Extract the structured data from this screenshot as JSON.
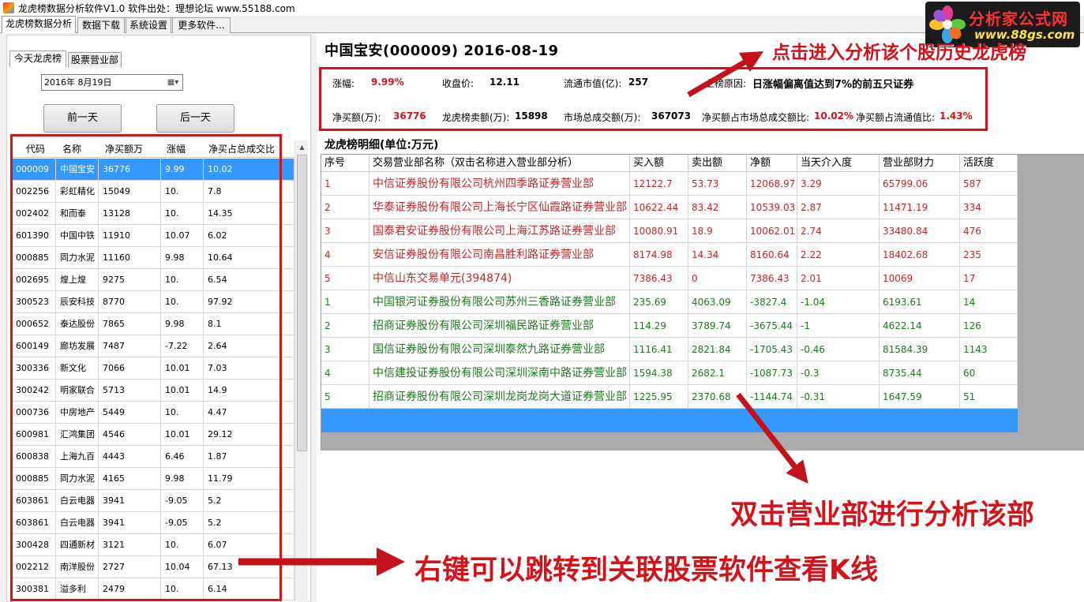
{
  "window": {
    "title": "龙虎榜数据分析软件V1.0 软件出处：理想论坛 www.55188.com"
  },
  "main_tabs": [
    {
      "label": "龙虎榜数据分析"
    },
    {
      "label": "数据下载"
    },
    {
      "label": "系统设置"
    },
    {
      "label": "更多软件..."
    }
  ],
  "left": {
    "tabs": [
      {
        "label": "今天龙虎榜"
      },
      {
        "label": "股票营业部"
      }
    ],
    "date_value": "2016年  8月19日",
    "calendar_icon": "calendar-dropdown-icon",
    "prev_label": "前一天",
    "next_label": "后一天",
    "columns": [
      "代码",
      "名称",
      "净买额万",
      "涨幅",
      "净买占总成交比"
    ],
    "rows": [
      [
        "000009",
        "中国宝安",
        "36776",
        "9.99",
        "10.02"
      ],
      [
        "002256",
        "彩虹精化",
        "15049",
        "10.",
        "7.8"
      ],
      [
        "002402",
        "和而泰",
        "13128",
        "10.",
        "14.35"
      ],
      [
        "601390",
        "中国中铁",
        "11910",
        "10.07",
        "6.02"
      ],
      [
        "000885",
        "同力水泥",
        "11160",
        "9.98",
        "10.64"
      ],
      [
        "002695",
        "煌上煌",
        "9275",
        "10.",
        "6.54"
      ],
      [
        "300523",
        "辰安科技",
        "8770",
        "10.",
        "97.92"
      ],
      [
        "000652",
        "泰达股份",
        "7865",
        "9.98",
        "8.1"
      ],
      [
        "600149",
        "廊坊发展",
        "7487",
        "-7.22",
        "2.64"
      ],
      [
        "300336",
        "新文化",
        "7066",
        "10.01",
        "7.03"
      ],
      [
        "300242",
        "明家联合",
        "5713",
        "10.01",
        "14.9"
      ],
      [
        "000736",
        "中房地产",
        "5449",
        "10.",
        "4.47"
      ],
      [
        "600981",
        "汇鸿集团",
        "4546",
        "10.01",
        "29.12"
      ],
      [
        "600838",
        "上海九百",
        "4443",
        "6.46",
        "1.87"
      ],
      [
        "000885",
        "同力水泥",
        "4165",
        "9.98",
        "11.79"
      ],
      [
        "603861",
        "白云电器",
        "3941",
        "-9.05",
        "5.2"
      ],
      [
        "603861",
        "白云电器",
        "3941",
        "-9.05",
        "5.2"
      ],
      [
        "300428",
        "四通新材",
        "3121",
        "10.",
        "6.07"
      ],
      [
        "002212",
        "南洋股份",
        "2727",
        "10.04",
        "67.13"
      ],
      [
        "300381",
        "溢多利",
        "2479",
        "10.",
        "6.14"
      ]
    ]
  },
  "stock": {
    "title": "中国宝安(000009)  2016-08-19",
    "change_label": "涨幅:",
    "change_value": "9.99%",
    "close_label": "收盘价:",
    "close_value": "12.11",
    "mcap_label": "流通市值(亿):",
    "mcap_value": "257",
    "reason_label": "上榜原因:",
    "reason_value": "日涨幅偏离值达到7%的前五只证券",
    "netbuy_label": "净买额(万):",
    "netbuy_value": "36776",
    "lhb_sell_label": "龙虎榜卖额(万):",
    "lhb_sell_value": "15898",
    "total_label": "市场总成交额(万):",
    "total_value": "367073",
    "ratio_total_label": "净买额占市场总成交额比:",
    "ratio_total_value": "10.02%",
    "ratio_float_label": "净买额占流通值比:",
    "ratio_float_value": "1.43%"
  },
  "detail": {
    "title": "龙虎榜明细(单位:万元)",
    "columns": [
      "序号",
      "交易营业部名称（双击名称进入营业部分析）",
      "买入额",
      "卖出额",
      "净额",
      "当天介入度",
      "营业部财力",
      "活跃度"
    ],
    "rows": [
      [
        "1",
        "中信证券股份有限公司杭州四季路证券营业部",
        "12122.7",
        "53.73",
        "12068.97",
        "3.29",
        "65799.06",
        "587"
      ],
      [
        "2",
        "华泰证券股份有限公司上海长宁区仙霞路证券营业部",
        "10622.44",
        "83.42",
        "10539.03",
        "2.87",
        "11471.19",
        "334"
      ],
      [
        "3",
        "国泰君安证券股份有限公司上海江苏路证券营业部",
        "10080.91",
        "18.9",
        "10062.01",
        "2.74",
        "33480.84",
        "476"
      ],
      [
        "4",
        "安信证券股份有限公司南昌胜利路证券营业部",
        "8174.98",
        "14.34",
        "8160.64",
        "2.22",
        "18402.68",
        "235"
      ],
      [
        "5",
        "中信山东交易单元(394874)",
        "7386.43",
        "0",
        "7386.43",
        "2.01",
        "10069",
        "17"
      ],
      [
        "1",
        "中国银河证券股份有限公司苏州三香路证券营业部",
        "235.69",
        "4063.09",
        "-3827.4",
        "-1.04",
        "6193.61",
        "14"
      ],
      [
        "2",
        "招商证券股份有限公司深圳福民路证券营业部",
        "114.29",
        "3789.74",
        "-3675.44",
        "-1",
        "4622.14",
        "126"
      ],
      [
        "3",
        "国信证券股份有限公司深圳泰然九路证券营业部",
        "1116.41",
        "2821.84",
        "-1705.43",
        "-0.46",
        "81584.39",
        "1143"
      ],
      [
        "4",
        "中信建投证券股份有限公司深圳深南中路证券营业部",
        "1594.38",
        "2682.1",
        "-1087.73",
        "-0.3",
        "8735.44",
        "60"
      ],
      [
        "5",
        "招商证券股份有限公司深圳龙岗龙岗大道证券营业部",
        "1225.95",
        "2370.68",
        "-1144.74",
        "-0.31",
        "1647.59",
        "51"
      ]
    ]
  },
  "annotations": {
    "top": "点击进入分析该个股历史龙虎榜",
    "middle": "双击营业部进行分析该部",
    "bottom": "右键可以跳转到关联股票软件查看K线"
  },
  "logo": {
    "line1": "分析家公式网",
    "line2": "www.88gs.com"
  },
  "colors": {
    "accent_red": "#d4121a",
    "selection_blue": "#3399ff",
    "buy_text": "#c0282a",
    "sell_text": "#1e7a1e"
  }
}
